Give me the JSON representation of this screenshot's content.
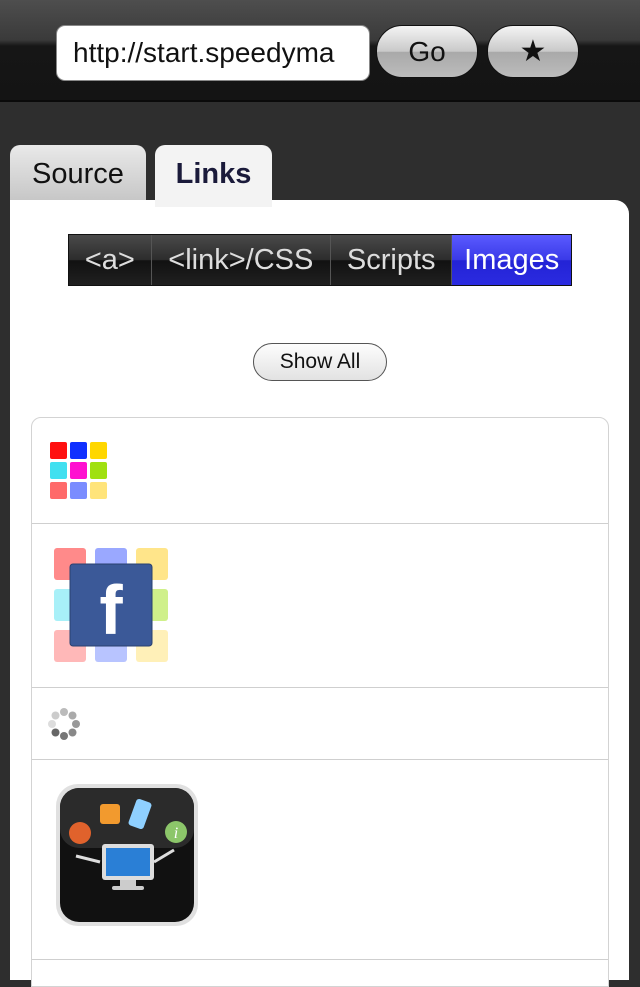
{
  "toolbar": {
    "url": "http://start.speedyma",
    "go_label": "Go",
    "bookmark_label": "★"
  },
  "tabs": [
    {
      "label": "Source",
      "selected": false
    },
    {
      "label": "Links",
      "selected": true
    }
  ],
  "filter": {
    "segments": [
      {
        "label": "<a>",
        "selected": false
      },
      {
        "label": "<link>/CSS",
        "selected": false
      },
      {
        "label": "Scripts",
        "selected": false
      },
      {
        "label": "Images",
        "selected": true
      }
    ],
    "show_all_label": "Show All"
  },
  "images": [
    {
      "icon": "color-grid-icon"
    },
    {
      "icon": "facebook-icon"
    },
    {
      "icon": "loading-spinner-icon"
    },
    {
      "icon": "app-icon"
    }
  ],
  "colors": {
    "selected_segment": "#2b2be0",
    "toolbar": "#141414"
  }
}
